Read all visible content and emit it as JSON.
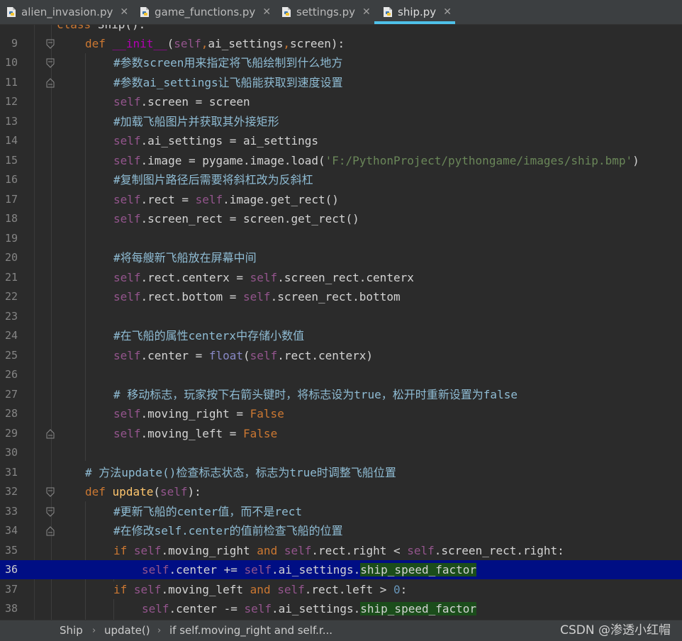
{
  "tabs": [
    {
      "label": "alien_invasion.py",
      "close": "✕"
    },
    {
      "label": "game_functions.py",
      "close": "✕"
    },
    {
      "label": "settings.py",
      "close": "✕"
    },
    {
      "label": "ship.py",
      "close": "✕",
      "active": true
    }
  ],
  "code_lines": [
    {
      "n": "",
      "text": "class Ship():"
    },
    {
      "n": "9",
      "text": "def __init__(self,ai_settings,screen):"
    },
    {
      "n": "10",
      "text": "#参数screen用来指定将飞船绘制到什么地方"
    },
    {
      "n": "11",
      "text": "#参数ai_settings让飞船能获取到速度设置"
    },
    {
      "n": "12",
      "text": "self.screen = screen"
    },
    {
      "n": "13",
      "text": "#加载飞船图片并获取其外接矩形"
    },
    {
      "n": "14",
      "text": "self.ai_settings = ai_settings"
    },
    {
      "n": "15",
      "text": "self.image = pygame.image.load('F:/PythonProject/pythongame/images/ship.bmp')"
    },
    {
      "n": "16",
      "text": "#复制图片路径后需要将斜杠改为反斜杠"
    },
    {
      "n": "17",
      "text": "self.rect = self.image.get_rect()"
    },
    {
      "n": "18",
      "text": "self.screen_rect = screen.get_rect()"
    },
    {
      "n": "19",
      "text": ""
    },
    {
      "n": "20",
      "text": "#将每艘新飞船放在屏幕中间"
    },
    {
      "n": "21",
      "text": "self.rect.centerx = self.screen_rect.centerx"
    },
    {
      "n": "22",
      "text": "self.rect.bottom = self.screen_rect.bottom"
    },
    {
      "n": "23",
      "text": ""
    },
    {
      "n": "24",
      "text": "#在飞船的属性centerx中存储小数值"
    },
    {
      "n": "25",
      "text": "self.center = float(self.rect.centerx)"
    },
    {
      "n": "26",
      "text": ""
    },
    {
      "n": "27",
      "text": "# 移动标志，玩家按下右箭头键时，将标志设为true，松开时重新设置为false"
    },
    {
      "n": "28",
      "text": "self.moving_right = False"
    },
    {
      "n": "29",
      "text": "self.moving_left = False"
    },
    {
      "n": "30",
      "text": ""
    },
    {
      "n": "31",
      "text": "# 方法update()检查标志状态，标志为true时调整飞船位置"
    },
    {
      "n": "32",
      "text": "def update(self):"
    },
    {
      "n": "33",
      "text": "#更新飞船的center值，而不是rect"
    },
    {
      "n": "34",
      "text": "#在修改self.center的值前检查飞船的位置"
    },
    {
      "n": "35",
      "text": "if self.moving_right and self.rect.right < self.screen_rect.right:"
    },
    {
      "n": "36",
      "text": "self.center += self.ai_settings.ship_speed_factor"
    },
    {
      "n": "37",
      "text": "if self.moving_left and self.rect.left > 0:"
    },
    {
      "n": "38",
      "text": "self.center -= self.ai_settings.ship_speed_factor"
    }
  ],
  "breadcrumb": {
    "item1": "Ship",
    "item2": "update()",
    "item3": "if self.moving_right and self.r...",
    "sep": "›"
  },
  "watermark": "CSDN @渗透小红帽",
  "colors": {
    "background": "#2b2b2b",
    "current_line": "#000e84",
    "tab_active_underline": "#4fc1e9"
  }
}
